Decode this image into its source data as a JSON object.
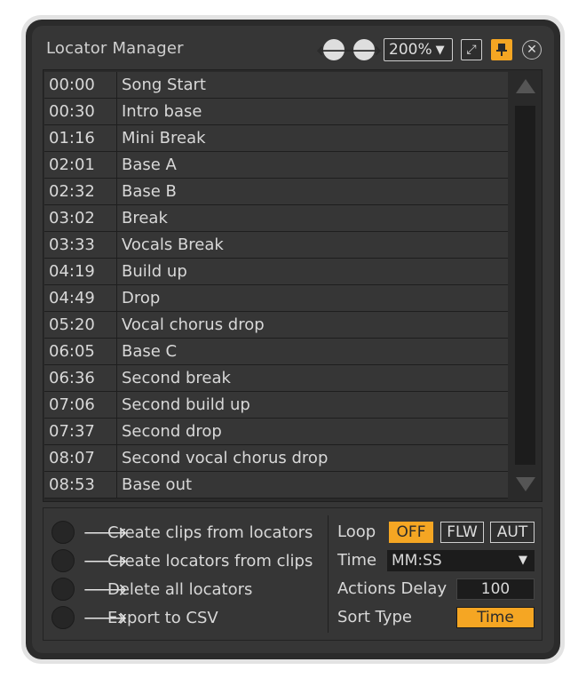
{
  "window": {
    "title": "Locator Manager"
  },
  "toolbar": {
    "back_glyph": "🡐",
    "forward_glyph": "🡒",
    "zoom_value": "200%",
    "zoom_arrow": "▼",
    "expand_glyph": "⤢",
    "pin_glyph": "📌",
    "close_glyph": "✕"
  },
  "locators": [
    {
      "time": "00:00",
      "name": "Song Start"
    },
    {
      "time": "00:30",
      "name": "Intro base"
    },
    {
      "time": "01:16",
      "name": "Mini Break"
    },
    {
      "time": "02:01",
      "name": "Base A"
    },
    {
      "time": "02:32",
      "name": "Base B"
    },
    {
      "time": "03:02",
      "name": "Break"
    },
    {
      "time": "03:33",
      "name": "Vocals Break"
    },
    {
      "time": "04:19",
      "name": "Build up"
    },
    {
      "time": "04:49",
      "name": "Drop"
    },
    {
      "time": "05:20",
      "name": "Vocal chorus drop"
    },
    {
      "time": "06:05",
      "name": "Base C"
    },
    {
      "time": "06:36",
      "name": "Second break"
    },
    {
      "time": "07:06",
      "name": "Second build up"
    },
    {
      "time": "07:37",
      "name": "Second drop"
    },
    {
      "time": "08:07",
      "name": "Second vocal chorus drop"
    },
    {
      "time": "08:53",
      "name": "Base out"
    }
  ],
  "actions": [
    {
      "arrow": "🡒",
      "label": "Create clips from locators"
    },
    {
      "arrow": "🡒",
      "label": "Create locators from clips"
    },
    {
      "arrow": "🡒",
      "label": "Delete all locators"
    },
    {
      "arrow": "🡒",
      "label": "Export to CSV"
    }
  ],
  "settings": {
    "loop_label": "Loop",
    "loop_options": [
      "OFF",
      "FLW",
      "AUT"
    ],
    "loop_selected": "OFF",
    "time_label": "Time",
    "time_value": "MM:SS",
    "time_arrow": "▼",
    "delay_label": "Actions Delay",
    "delay_value": "100",
    "sort_label": "Sort Type",
    "sort_value": "Time"
  },
  "colors": {
    "accent": "#f5a623",
    "panel": "#363636",
    "background": "#2b2b2b"
  }
}
